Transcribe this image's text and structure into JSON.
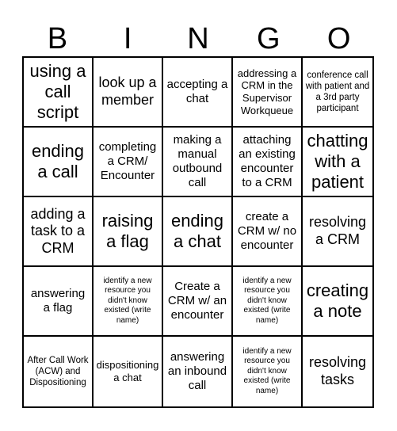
{
  "header": {
    "letters": [
      "B",
      "I",
      "N",
      "G",
      "O"
    ]
  },
  "board": {
    "cells": [
      {
        "text": "using a call script",
        "size": "xl"
      },
      {
        "text": "look up a member",
        "size": "l"
      },
      {
        "text": "accepting a chat",
        "size": "m"
      },
      {
        "text": "addressing a CRM in the Supervisor Workqueue",
        "size": "s"
      },
      {
        "text": "conference call with patient and a 3rd party participant",
        "size": "xs"
      },
      {
        "text": "ending a call",
        "size": "xl"
      },
      {
        "text": "completing a CRM/ Encounter",
        "size": "m"
      },
      {
        "text": "making a manual outbound call",
        "size": "m"
      },
      {
        "text": "attaching an existing encounter to a CRM",
        "size": "m"
      },
      {
        "text": "chatting with a patient",
        "size": "xl"
      },
      {
        "text": "adding a task to a CRM",
        "size": "l"
      },
      {
        "text": "raising a flag",
        "size": "xl"
      },
      {
        "text": "ending a chat",
        "size": "xl"
      },
      {
        "text": "create a CRM w/ no encounter",
        "size": "m"
      },
      {
        "text": "resolving a CRM",
        "size": "l"
      },
      {
        "text": "answering a flag",
        "size": "m"
      },
      {
        "text": "identify a new resource you didn't know existed (write name)",
        "size": "xxs"
      },
      {
        "text": "Create a CRM w/ an encounter",
        "size": "m"
      },
      {
        "text": "identify a new resource you didn't know existed (write name)",
        "size": "xxs"
      },
      {
        "text": "creating a note",
        "size": "xl"
      },
      {
        "text": "After Call Work (ACW) and Dispositioning",
        "size": "xs"
      },
      {
        "text": "dispositioning a chat",
        "size": "s"
      },
      {
        "text": "answering an inbound call",
        "size": "m"
      },
      {
        "text": "identify a new resource you didn't know existed (write name)",
        "size": "xxs"
      },
      {
        "text": "resolving tasks",
        "size": "l"
      }
    ]
  }
}
